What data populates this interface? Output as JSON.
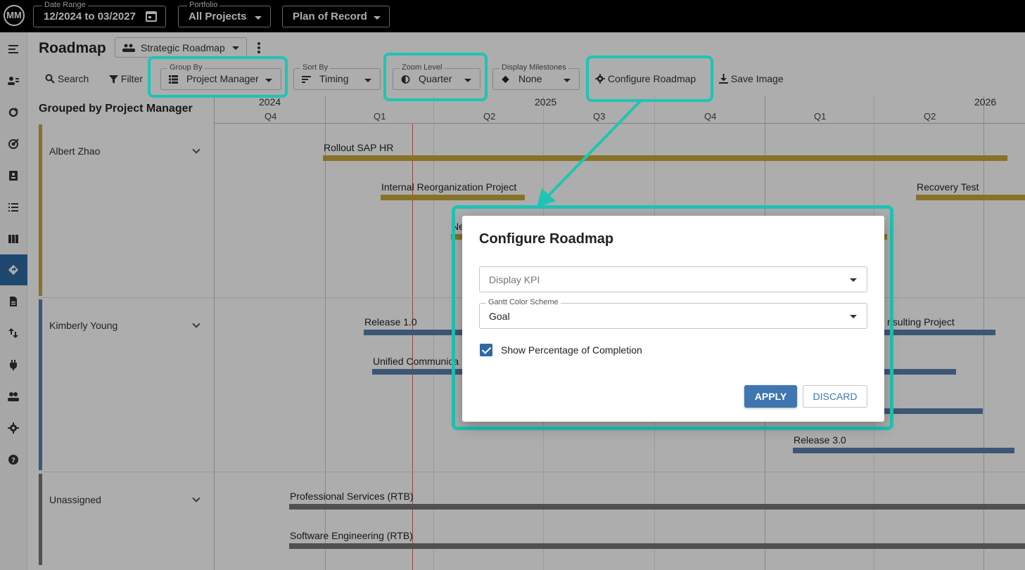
{
  "topbar": {
    "logo_text": "MM",
    "date_range": {
      "label": "Date Range",
      "value": "12/2024 to 03/2027"
    },
    "portfolio": {
      "label": "Portfolio",
      "value": "All Projects"
    },
    "plan": {
      "value": "Plan of Record"
    }
  },
  "rail": {
    "active_item": "roadmap-icon",
    "items": [
      "menu-icon",
      "user-list-icon",
      "refresh-icon",
      "target-icon",
      "assignment-icon",
      "list-icon",
      "board-icon",
      "roadmap-icon",
      "document-icon",
      "swap-icon",
      "plug-icon",
      "people-icon",
      "gear-icon",
      "help-icon"
    ]
  },
  "header": {
    "title": "Roadmap",
    "roadmap_select": "Strategic Roadmap"
  },
  "toolbar": {
    "search": "Search",
    "filter": "Filter",
    "group_by": {
      "label": "Group By",
      "value": "Project Manager"
    },
    "sort_by": {
      "label": "Sort By",
      "value": "Timing"
    },
    "zoom_level": {
      "label": "Zoom Level",
      "value": "Quarter"
    },
    "display_milestones": {
      "label": "Display Milestones",
      "value": "None"
    },
    "configure": "Configure Roadmap",
    "save_image": "Save Image"
  },
  "gantt": {
    "group_heading": "Grouped by Project Manager",
    "years": [
      "2024",
      "2025",
      "2026"
    ],
    "quarters": [
      "Q4",
      "Q1",
      "Q2",
      "Q3",
      "Q4",
      "Q1",
      "Q2"
    ],
    "groups": [
      {
        "name": "Albert Zhao",
        "color": "#c8a93a"
      },
      {
        "name": "Kimberly Young",
        "color": "#5b7fad"
      },
      {
        "name": "Unassigned",
        "color": "#777777"
      }
    ],
    "tasks": [
      {
        "label": "Rollout SAP HR",
        "color": "#c8a93a"
      },
      {
        "label": "Internal Reorganization Project",
        "color": "#c8a93a"
      },
      {
        "label": "Recovery Test",
        "color": "#c8a93a"
      },
      {
        "label": "Ne",
        "color": "#c8a93a"
      },
      {
        "label": "Release 1.0",
        "color": "#5b7fad"
      },
      {
        "label": "Unified Communica",
        "color": "#5b7fad"
      },
      {
        "label": "nsulting Project",
        "color": "#5b7fad"
      },
      {
        "label": "Release 3.0",
        "color": "#5b7fad"
      },
      {
        "label": "Professional Services (RTB)",
        "color": "#777777"
      },
      {
        "label": "Software Engineering (RTB)",
        "color": "#777777"
      }
    ]
  },
  "dialog": {
    "title": "Configure Roadmap",
    "display_kpi": {
      "placeholder": "Display KPI",
      "value": ""
    },
    "gantt_color_scheme": {
      "label": "Gantt Color Scheme",
      "value": "Goal"
    },
    "show_percentage": {
      "label": "Show Percentage of Completion",
      "checked": true
    },
    "apply": "APPLY",
    "discard": "DISCARD"
  },
  "colors": {
    "highlight": "#1fc4b4",
    "accent": "#3f76b1",
    "topbar": "#000000"
  }
}
